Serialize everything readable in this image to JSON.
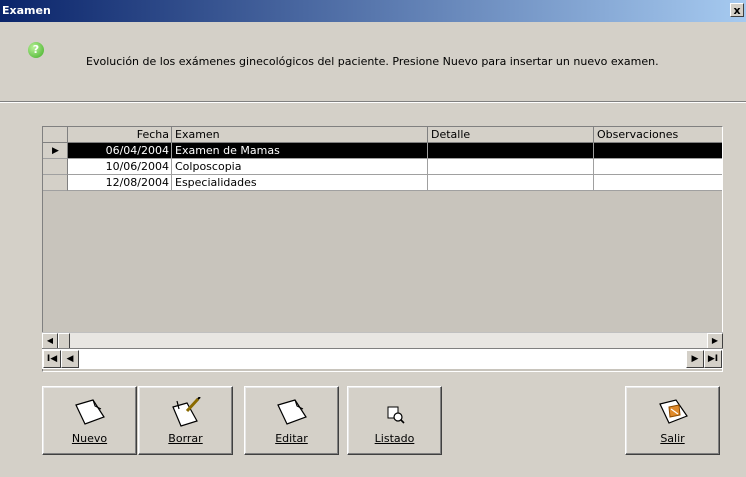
{
  "window": {
    "title": "Examen",
    "close_label": "x"
  },
  "info": {
    "icon": "help-icon",
    "text": "Evolución de los exámenes ginecológicos del paciente. Presione Nuevo para insertar un nuevo examen."
  },
  "grid": {
    "columns": [
      "Fecha",
      "Examen",
      "Detalle",
      "Observaciones"
    ],
    "rows": [
      {
        "fecha": "06/04/2004",
        "examen": "Examen de Mamas",
        "detalle": "",
        "observaciones": "",
        "selected": true
      },
      {
        "fecha": "10/06/2004",
        "examen": "Colposcopia",
        "detalle": "",
        "observaciones": ""
      },
      {
        "fecha": "12/08/2004",
        "examen": "Especialidades",
        "detalle": "",
        "observaciones": ""
      }
    ],
    "current_row_indicator": "▶"
  },
  "navigator": {
    "first": "I◀",
    "prev": "◀",
    "next": "▶",
    "last": "▶I"
  },
  "buttons": {
    "nuevo": "Nuevo",
    "borrar": "Borrar",
    "editar": "Editar",
    "listado": "Listado",
    "salir": "Salir"
  }
}
